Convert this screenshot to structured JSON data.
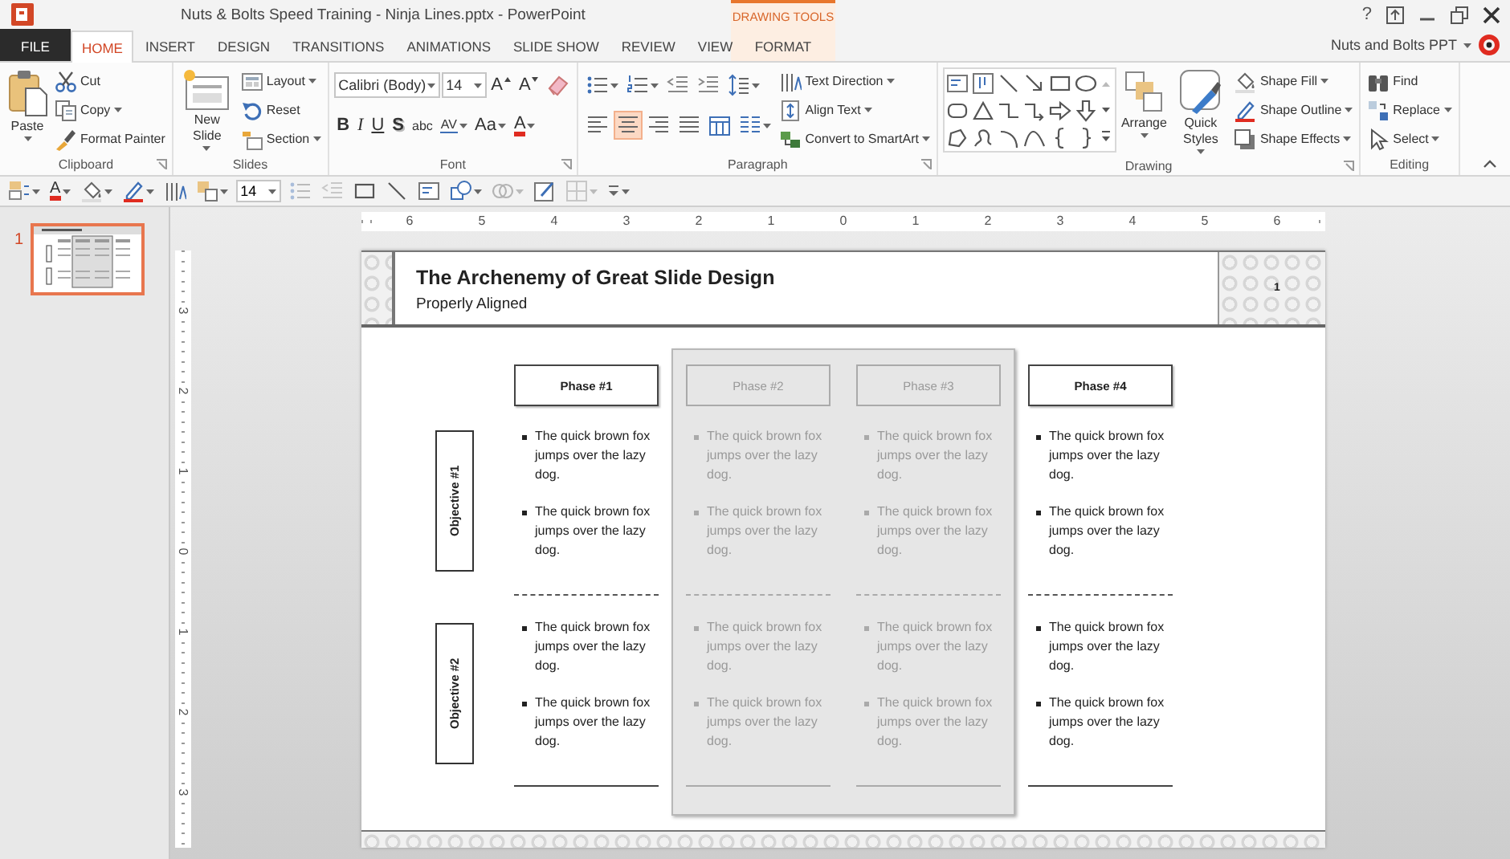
{
  "window": {
    "title": "Nuts & Bolts Speed Training - Ninja Lines.pptx - PowerPoint",
    "help": "?"
  },
  "contextual_tab_group": {
    "label": "DRAWING TOOLS"
  },
  "tabs": [
    {
      "label": "FILE",
      "kind": "file",
      "selected": false
    },
    {
      "label": "HOME",
      "kind": "normal",
      "selected": true
    },
    {
      "label": "INSERT",
      "kind": "normal",
      "selected": false
    },
    {
      "label": "DESIGN",
      "kind": "normal",
      "selected": false
    },
    {
      "label": "TRANSITIONS",
      "kind": "normal",
      "selected": false
    },
    {
      "label": "ANIMATIONS",
      "kind": "normal",
      "selected": false
    },
    {
      "label": "SLIDE SHOW",
      "kind": "normal",
      "selected": false
    },
    {
      "label": "REVIEW",
      "kind": "normal",
      "selected": false
    },
    {
      "label": "VIEW",
      "kind": "normal",
      "selected": false
    },
    {
      "label": "FORMAT",
      "kind": "contextual",
      "selected": false
    }
  ],
  "account": {
    "name": "Nuts and Bolts PPT"
  },
  "ribbon": [
    {
      "label": "Clipboard",
      "launcher": true,
      "columns": [
        {
          "kind": "large",
          "label": "Paste",
          "menu": true
        },
        {
          "kind": "stack",
          "items": [
            {
              "label": "Cut",
              "menu": false
            },
            {
              "label": "Copy",
              "menu": true
            },
            {
              "label": "Format Painter",
              "menu": false
            }
          ]
        }
      ]
    },
    {
      "label": "Slides",
      "launcher": false,
      "columns": [
        {
          "kind": "large",
          "label": "New Slide",
          "menu": true
        },
        {
          "kind": "stack",
          "items": [
            {
              "label": "Layout",
              "menu": true
            },
            {
              "label": "Reset",
              "menu": false
            },
            {
              "label": "Section",
              "menu": true
            }
          ]
        }
      ]
    },
    {
      "label": "Font",
      "launcher": true,
      "columns": [
        {
          "kind": "bars",
          "bars": [
            {
              "tools": [
                {
                  "kind": "field",
                  "value": "Calibri (Body)",
                  "menu": true
                },
                {
                  "kind": "field",
                  "value": "14",
                  "menu": true
                },
                {
                  "kind": "grow",
                  "label": "A",
                  "menu": false
                },
                {
                  "kind": "shrink",
                  "label": "A",
                  "menu": false
                },
                {
                  "kind": "icon",
                  "menu": false
                }
              ]
            },
            {
              "tools": [
                {
                  "kind": "bold",
                  "label": "B",
                  "menu": false
                },
                {
                  "kind": "italic",
                  "label": "I",
                  "menu": false
                },
                {
                  "kind": "underline",
                  "label": "U",
                  "menu": false
                },
                {
                  "kind": "shadow",
                  "label": "S",
                  "menu": false
                },
                {
                  "kind": "strike",
                  "label": "abc",
                  "menu": false
                },
                {
                  "kind": "spacing",
                  "label": "AV",
                  "menu": true
                },
                {
                  "kind": "case",
                  "label": "Aa",
                  "menu": true
                },
                {
                  "kind": "color",
                  "label": "A",
                  "menu": true
                }
              ]
            }
          ]
        }
      ]
    },
    {
      "label": "Paragraph",
      "launcher": true,
      "columns": [
        {
          "kind": "bars",
          "bars": [
            {
              "tools": [
                {
                  "kind": "icon",
                  "menu": true
                },
                {
                  "kind": "icon",
                  "menu": true
                },
                {
                  "kind": "icon",
                  "menu": false
                },
                {
                  "kind": "icon",
                  "menu": false
                },
                {
                  "kind": "icon",
                  "menu": true
                }
              ]
            },
            {
              "tools": [
                {
                  "kind": "align",
                  "selected": false,
                  "menu": false
                },
                {
                  "kind": "align",
                  "selected": true,
                  "menu": false
                },
                {
                  "kind": "align",
                  "selected": false,
                  "menu": false
                },
                {
                  "kind": "align",
                  "selected": false,
                  "menu": false
                },
                {
                  "kind": "icon",
                  "menu": false
                },
                {
                  "kind": "icon",
                  "menu": true
                }
              ]
            }
          ]
        },
        {
          "kind": "stack",
          "items": [
            {
              "label": "Text Direction",
              "menu": true
            },
            {
              "label": "Align Text",
              "menu": true
            },
            {
              "label": "Convert to SmartArt",
              "menu": true
            }
          ]
        }
      ]
    },
    {
      "label": "Drawing",
      "launcher": true,
      "columns": [
        {
          "kind": "gallery"
        },
        {
          "kind": "large",
          "label": "Arrange",
          "menu": true
        },
        {
          "kind": "large",
          "label": "Quick Styles",
          "menu": true
        },
        {
          "kind": "stack",
          "items": [
            {
              "label": "Shape Fill",
              "menu": true
            },
            {
              "label": "Shape Outline",
              "menu": true
            },
            {
              "label": "Shape Effects",
              "menu": true
            }
          ]
        }
      ]
    },
    {
      "label": "Editing",
      "launcher": false,
      "columns": [
        {
          "kind": "stack",
          "items": [
            {
              "label": "Find",
              "menu": false
            },
            {
              "label": "Replace",
              "menu": true
            },
            {
              "label": "Select",
              "menu": true
            }
          ]
        }
      ]
    }
  ],
  "format_toolbar": [
    {
      "kind": "icon",
      "menu": true,
      "disabled": false
    },
    {
      "kind": "color",
      "label": "A",
      "menu": true,
      "disabled": false
    },
    {
      "kind": "icon",
      "menu": true,
      "disabled": false
    },
    {
      "kind": "icon",
      "menu": true,
      "disabled": false
    },
    {
      "kind": "icon",
      "menu": false,
      "disabled": false
    },
    {
      "kind": "icon",
      "menu": true,
      "disabled": false
    },
    {
      "kind": "field",
      "value": "14",
      "menu": true,
      "disabled": false
    },
    {
      "kind": "icon",
      "menu": false,
      "disabled": true
    },
    {
      "kind": "icon",
      "menu": false,
      "disabled": true
    },
    {
      "kind": "icon",
      "menu": false,
      "disabled": false
    },
    {
      "kind": "icon",
      "menu": false,
      "disabled": false
    },
    {
      "kind": "icon",
      "menu": false,
      "disabled": false
    },
    {
      "kind": "icon",
      "menu": true,
      "disabled": false
    },
    {
      "kind": "icon",
      "menu": true,
      "disabled": true
    },
    {
      "kind": "icon",
      "menu": false,
      "disabled": false
    },
    {
      "kind": "icon",
      "menu": true,
      "disabled": true
    },
    {
      "kind": "icon",
      "menu": true,
      "disabled": false
    }
  ],
  "rulers": {
    "horizontal": [
      "6",
      "5",
      "4",
      "3",
      "2",
      "1",
      "0",
      "1",
      "2",
      "3",
      "4",
      "5",
      "6"
    ],
    "vertical": [
      "3",
      "2",
      "1",
      "0",
      "1",
      "2",
      "3"
    ]
  },
  "slide_thumbnails": [
    {
      "number": "1",
      "selected": true
    }
  ],
  "slide": {
    "title": "The Archenemy of Great Slide Design",
    "subtitle": "Properly Aligned",
    "number": "1",
    "objectives": [
      "Objective #1",
      "Objective #2"
    ],
    "phases": [
      {
        "label": "Phase #1",
        "dimmed": false,
        "cells": [
          [
            "The quick brown fox jumps over the lazy dog.",
            "The quick brown fox jumps over the lazy dog."
          ],
          [
            "The quick brown fox jumps over the lazy dog.",
            "The quick brown fox jumps over the lazy dog."
          ]
        ]
      },
      {
        "label": "Phase #2",
        "dimmed": true,
        "cells": [
          [
            "The quick brown fox jumps over the lazy dog.",
            "The quick brown fox jumps over the lazy dog."
          ],
          [
            "The quick brown fox jumps over the lazy dog.",
            "The quick brown fox jumps over the lazy dog."
          ]
        ]
      },
      {
        "label": "Phase #3",
        "dimmed": true,
        "cells": [
          [
            "The quick brown fox jumps over the lazy dog.",
            "The quick brown fox jumps over the lazy dog."
          ],
          [
            "The quick brown fox jumps over the lazy dog.",
            "The quick brown fox jumps over the lazy dog."
          ]
        ]
      },
      {
        "label": "Phase #4",
        "dimmed": false,
        "cells": [
          [
            "The quick brown fox jumps over the lazy dog.",
            "The quick brown fox jumps over the lazy dog."
          ],
          [
            "The quick brown fox jumps over the lazy dog.",
            "The quick brown fox jumps over the lazy dog."
          ]
        ]
      }
    ]
  }
}
